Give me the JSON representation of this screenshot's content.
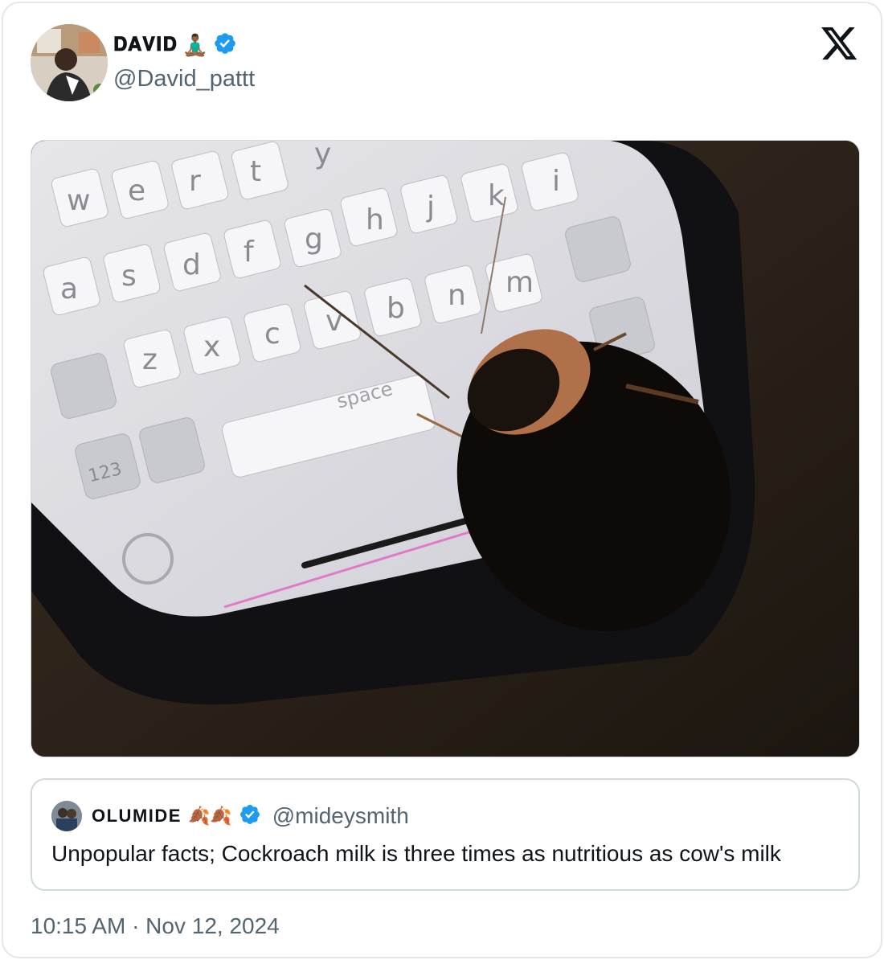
{
  "author": {
    "display_name": "𝐃𝐀𝐕𝐈𝐃",
    "display_name_emoji": "🧘🏾‍♂️",
    "handle": "@David_pattt",
    "verified": true
  },
  "media": {
    "description_icon": "photo-icon",
    "keyboard_keys_row1": [
      "w",
      "e",
      "r",
      "t",
      "y",
      "",
      "",
      "",
      "i"
    ],
    "keyboard_keys_row2": [
      "g",
      "h",
      "j",
      "k"
    ],
    "keyboard_keys_row3": [
      "a",
      "s",
      "d",
      "f",
      "g"
    ],
    "keyboard_keys_row4": [
      "z",
      "x",
      "c",
      "v",
      "b",
      "n",
      "m"
    ],
    "space_label": "space",
    "num_label": "123"
  },
  "quote": {
    "display_name": "OLUMIDE",
    "emoji": "🍂🍂",
    "handle": "@mideysmith",
    "text": "Unpopular facts; Cockroach milk is three times as nutritious as cow's milk",
    "verified": true
  },
  "timestamp": "10:15 AM · Nov 12, 2024",
  "colors": {
    "verified_blue": "#1d9bf0",
    "secondary_text": "#536471",
    "border": "#cfd9de"
  }
}
